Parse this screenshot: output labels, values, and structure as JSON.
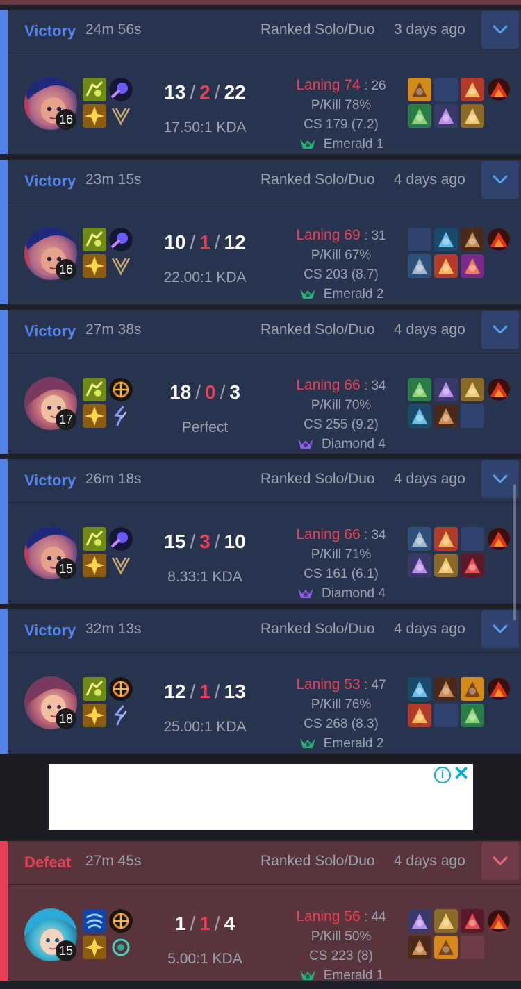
{
  "colors": {
    "win_accent": "#5383e8",
    "loss_accent": "#e84057",
    "win_bg": "#28344e",
    "loss_bg": "#59343b"
  },
  "matches": [
    {
      "result": "Victory",
      "duration": "24m 56s",
      "queue": "Ranked Solo/Duo",
      "ago": "3 days ago",
      "champion_level": "16",
      "champion_icon": "jinx-like-champion-portrait",
      "spells": [
        "ghost-spell-icon",
        "flash-spell-icon"
      ],
      "runes": [
        "primary-rune-icon",
        "secondary-rune-icon"
      ],
      "kills": "13",
      "deaths": "2",
      "assists": "22",
      "kda_ratio": "17.50:1 KDA",
      "laning": "Laning 74",
      "laning_vs": ": 26",
      "pkill": "P/Kill 78%",
      "cs": "CS 179 (7.2)",
      "rank": "Emerald 1",
      "rank_color": "#27b07b",
      "items": [
        "item",
        "empty",
        "item",
        "ward",
        "item",
        "item",
        "item"
      ]
    },
    {
      "result": "Victory",
      "duration": "23m 15s",
      "queue": "Ranked Solo/Duo",
      "ago": "4 days ago",
      "champion_level": "16",
      "champion_icon": "jinx-like-champion-portrait",
      "kills": "10",
      "deaths": "1",
      "assists": "12",
      "kda_ratio": "22.00:1 KDA",
      "laning": "Laning 69",
      "laning_vs": ": 31",
      "pkill": "P/Kill 67%",
      "cs": "CS 203 (8.7)",
      "rank": "Emerald 2",
      "rank_color": "#27b07b",
      "items": [
        "empty",
        "item",
        "item",
        "ward",
        "item",
        "item",
        "item"
      ]
    },
    {
      "result": "Victory",
      "duration": "27m 38s",
      "queue": "Ranked Solo/Duo",
      "ago": "4 days ago",
      "champion_level": "17",
      "champion_icon": "female-champion-portrait",
      "kills": "18",
      "deaths": "0",
      "assists": "3",
      "kda_ratio": "Perfect",
      "laning": "Laning 66",
      "laning_vs": ": 34",
      "pkill": "P/Kill 70%",
      "cs": "CS 255 (9.2)",
      "rank": "Diamond 4",
      "rank_color": "#8a5be8",
      "items": [
        "item",
        "item",
        "item",
        "ward",
        "item",
        "item",
        "empty"
      ]
    },
    {
      "result": "Victory",
      "duration": "26m 18s",
      "queue": "Ranked Solo/Duo",
      "ago": "4 days ago",
      "champion_level": "15",
      "champion_icon": "jinx-like-champion-portrait",
      "kills": "15",
      "deaths": "3",
      "assists": "10",
      "kda_ratio": "8.33:1 KDA",
      "laning": "Laning 66",
      "laning_vs": ": 34",
      "pkill": "P/Kill 71%",
      "cs": "CS 161 (6.1)",
      "rank": "Diamond 4",
      "rank_color": "#8a5be8",
      "items": [
        "item",
        "item",
        "empty",
        "ward",
        "item",
        "item",
        "item"
      ]
    },
    {
      "result": "Victory",
      "duration": "32m 13s",
      "queue": "Ranked Solo/Duo",
      "ago": "4 days ago",
      "champion_level": "18",
      "champion_icon": "female-champion-portrait",
      "kills": "12",
      "deaths": "1",
      "assists": "13",
      "kda_ratio": "25.00:1 KDA",
      "laning": "Laning 53",
      "laning_vs": ": 47",
      "pkill": "P/Kill 76%",
      "cs": "CS 268 (8.3)",
      "rank": "Emerald 2",
      "rank_color": "#27b07b",
      "items": [
        "item",
        "item",
        "item",
        "ward",
        "item",
        "empty",
        "item"
      ]
    },
    {
      "result": "Defeat",
      "duration": "27m 45s",
      "queue": "Ranked Solo/Duo",
      "ago": "4 days ago",
      "champion_level": "15",
      "champion_icon": "blue-hair-champion-portrait",
      "kills": "1",
      "deaths": "1",
      "assists": "4",
      "kda_ratio": "5.00:1 KDA",
      "laning": "Laning 56",
      "laning_vs": ": 44",
      "pkill": "P/Kill 50%",
      "cs": "CS 223 (8)",
      "rank": "Emerald 1",
      "rank_color": "#27b07b",
      "items": [
        "item",
        "item",
        "item",
        "ward",
        "item",
        "item",
        "empty"
      ]
    }
  ],
  "ad": {
    "info_icon": "info-icon",
    "close_icon": "close-icon"
  }
}
